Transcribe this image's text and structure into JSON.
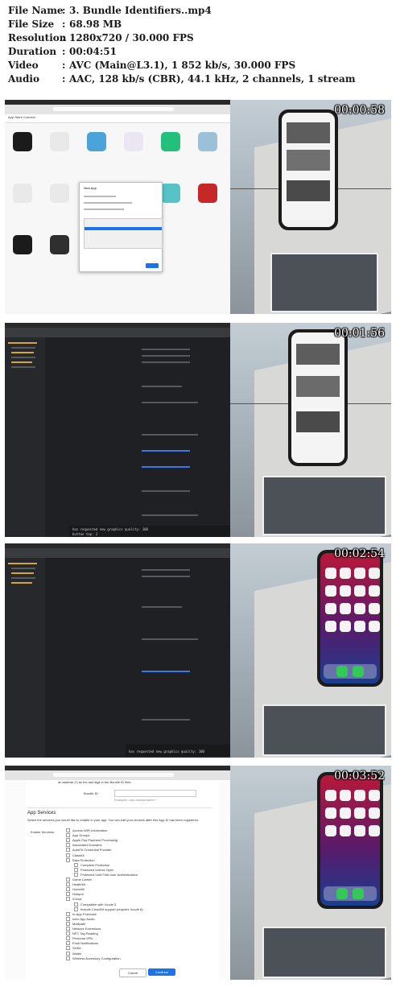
{
  "file_info": [
    {
      "label": "File Name",
      "value": "3. Bundle Identifiers..mp4"
    },
    {
      "label": "File Size",
      "value": "68.98 MB"
    },
    {
      "label": "Resolution",
      "value": "1280x720 / 30.000 FPS"
    },
    {
      "label": "Duration",
      "value": "00:04:51"
    },
    {
      "label": "Video",
      "value": "AVC (Main@L3.1), 1 852 kb/s, 30.000 FPS"
    },
    {
      "label": "Audio",
      "value": "AAC, 128 kb/s (CBR), 44.1 kHz, 2 channels, 1 stream"
    }
  ],
  "separator": ":",
  "thumbnails": [
    {
      "timestamp": "00:00:58",
      "content": "app-store-connect"
    },
    {
      "timestamp": "00:01:56",
      "content": "xcode"
    },
    {
      "timestamp": "00:02:54",
      "content": "xcode"
    },
    {
      "timestamp": "00:03:52",
      "content": "developer-portal"
    }
  ],
  "frame1": {
    "page_title": "App Store Connect",
    "dialog_title": "New App"
  },
  "frame2": {
    "debug_line1": "has requested new graphics quality: 100",
    "debug_line2": "button tap: 2"
  },
  "frame3": {
    "debug_line": "has requested new graphics quality: 100"
  },
  "frame4": {
    "intro_text": "an asterisk (*) as the last digit in the Bundle ID field.",
    "bundle_label": "Bundle ID:",
    "bundle_example": "Example: com.domainname.*",
    "section_title": "App Services",
    "section_desc": "Select the services you would like to enable in your app. You can edit your choices after this App ID has been registered.",
    "enable_label": "Enable Services:",
    "services": [
      "Access WiFi Information",
      "App Groups",
      "Apple Pay Payment Processing",
      "Associated Domains",
      "AutoFill Credential Provider",
      "ClassKit",
      "Data Protection",
      "Complete Protection",
      "Protected Unless Open",
      "Protected Until First User Authentication",
      "Game Center",
      "HealthKit",
      "HomeKit",
      "Hotspot",
      "iCloud",
      "Compatible with Xcode 5",
      "Include CloudKit support (requires Xcode 6)",
      "In-App Purchase",
      "Inter-App Audio",
      "Multipath",
      "Network Extensions",
      "NFC Tag Reading",
      "Personal VPN",
      "Push Notifications",
      "SiriKit",
      "Wallet",
      "Wireless Accessory Configuration"
    ],
    "cancel_label": "Cancel",
    "continue_label": "Continue"
  },
  "colors": {
    "accent_blue": "#1a73e8",
    "xcode_bg": "#1f2023",
    "timestamp_text": "#ffffff"
  }
}
